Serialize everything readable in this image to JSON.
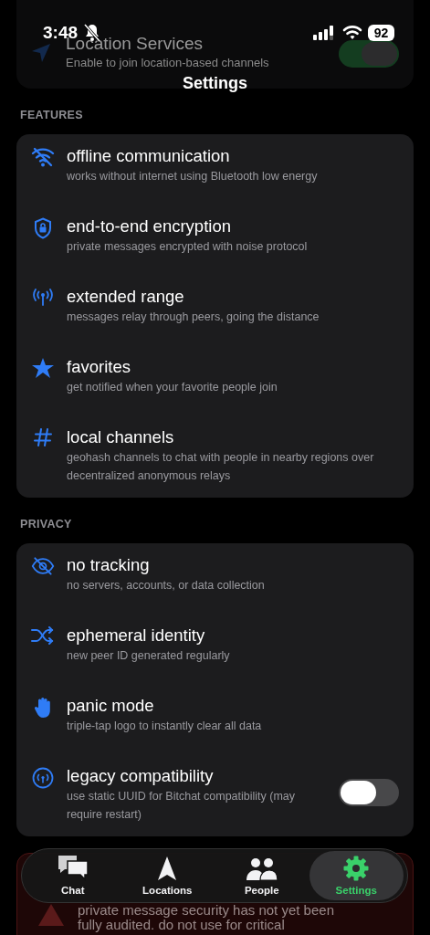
{
  "status_bar": {
    "time": "3:48",
    "battery": "92"
  },
  "background_card": {
    "title": "Location Services",
    "subtitle": "Enable to join location-based channels",
    "on": true
  },
  "title": "Settings",
  "sections": [
    {
      "header": "FEATURES",
      "rows": [
        {
          "kind": "info",
          "title": "offline communication",
          "subtitle": "works without internet using Bluetooth low energy"
        },
        {
          "kind": "info",
          "title": "end-to-end encryption",
          "subtitle": "private messages encrypted with noise protocol"
        },
        {
          "kind": "info",
          "title": "extended range",
          "subtitle": "messages relay through peers, going the distance"
        },
        {
          "kind": "info",
          "title": "favorites",
          "subtitle": "get notified when your favorite people join"
        },
        {
          "kind": "info",
          "title": "local channels",
          "subtitle": "geohash channels to chat with people in nearby regions over decentralized anonymous relays"
        }
      ]
    },
    {
      "header": "PRIVACY",
      "rows": [
        {
          "kind": "info",
          "title": "no tracking",
          "subtitle": "no servers, accounts, or data collection"
        },
        {
          "kind": "info",
          "title": "ephemeral identity",
          "subtitle": "new peer ID generated regularly"
        },
        {
          "kind": "info",
          "title": "panic mode",
          "subtitle": "triple-tap logo to instantly clear all data"
        },
        {
          "kind": "toggle",
          "title": "legacy compatibility",
          "subtitle": "use static UUID for Bitchat compatibility (may require restart)",
          "on": false
        }
      ]
    }
  ],
  "warning": {
    "lines": [
      "private message security has not yet been",
      "fully audited. do not use for critical"
    ]
  },
  "tabs": [
    {
      "label": "Chat",
      "selected": false
    },
    {
      "label": "Locations",
      "selected": false
    },
    {
      "label": "People",
      "selected": false
    },
    {
      "label": "Settings",
      "selected": true
    }
  ]
}
